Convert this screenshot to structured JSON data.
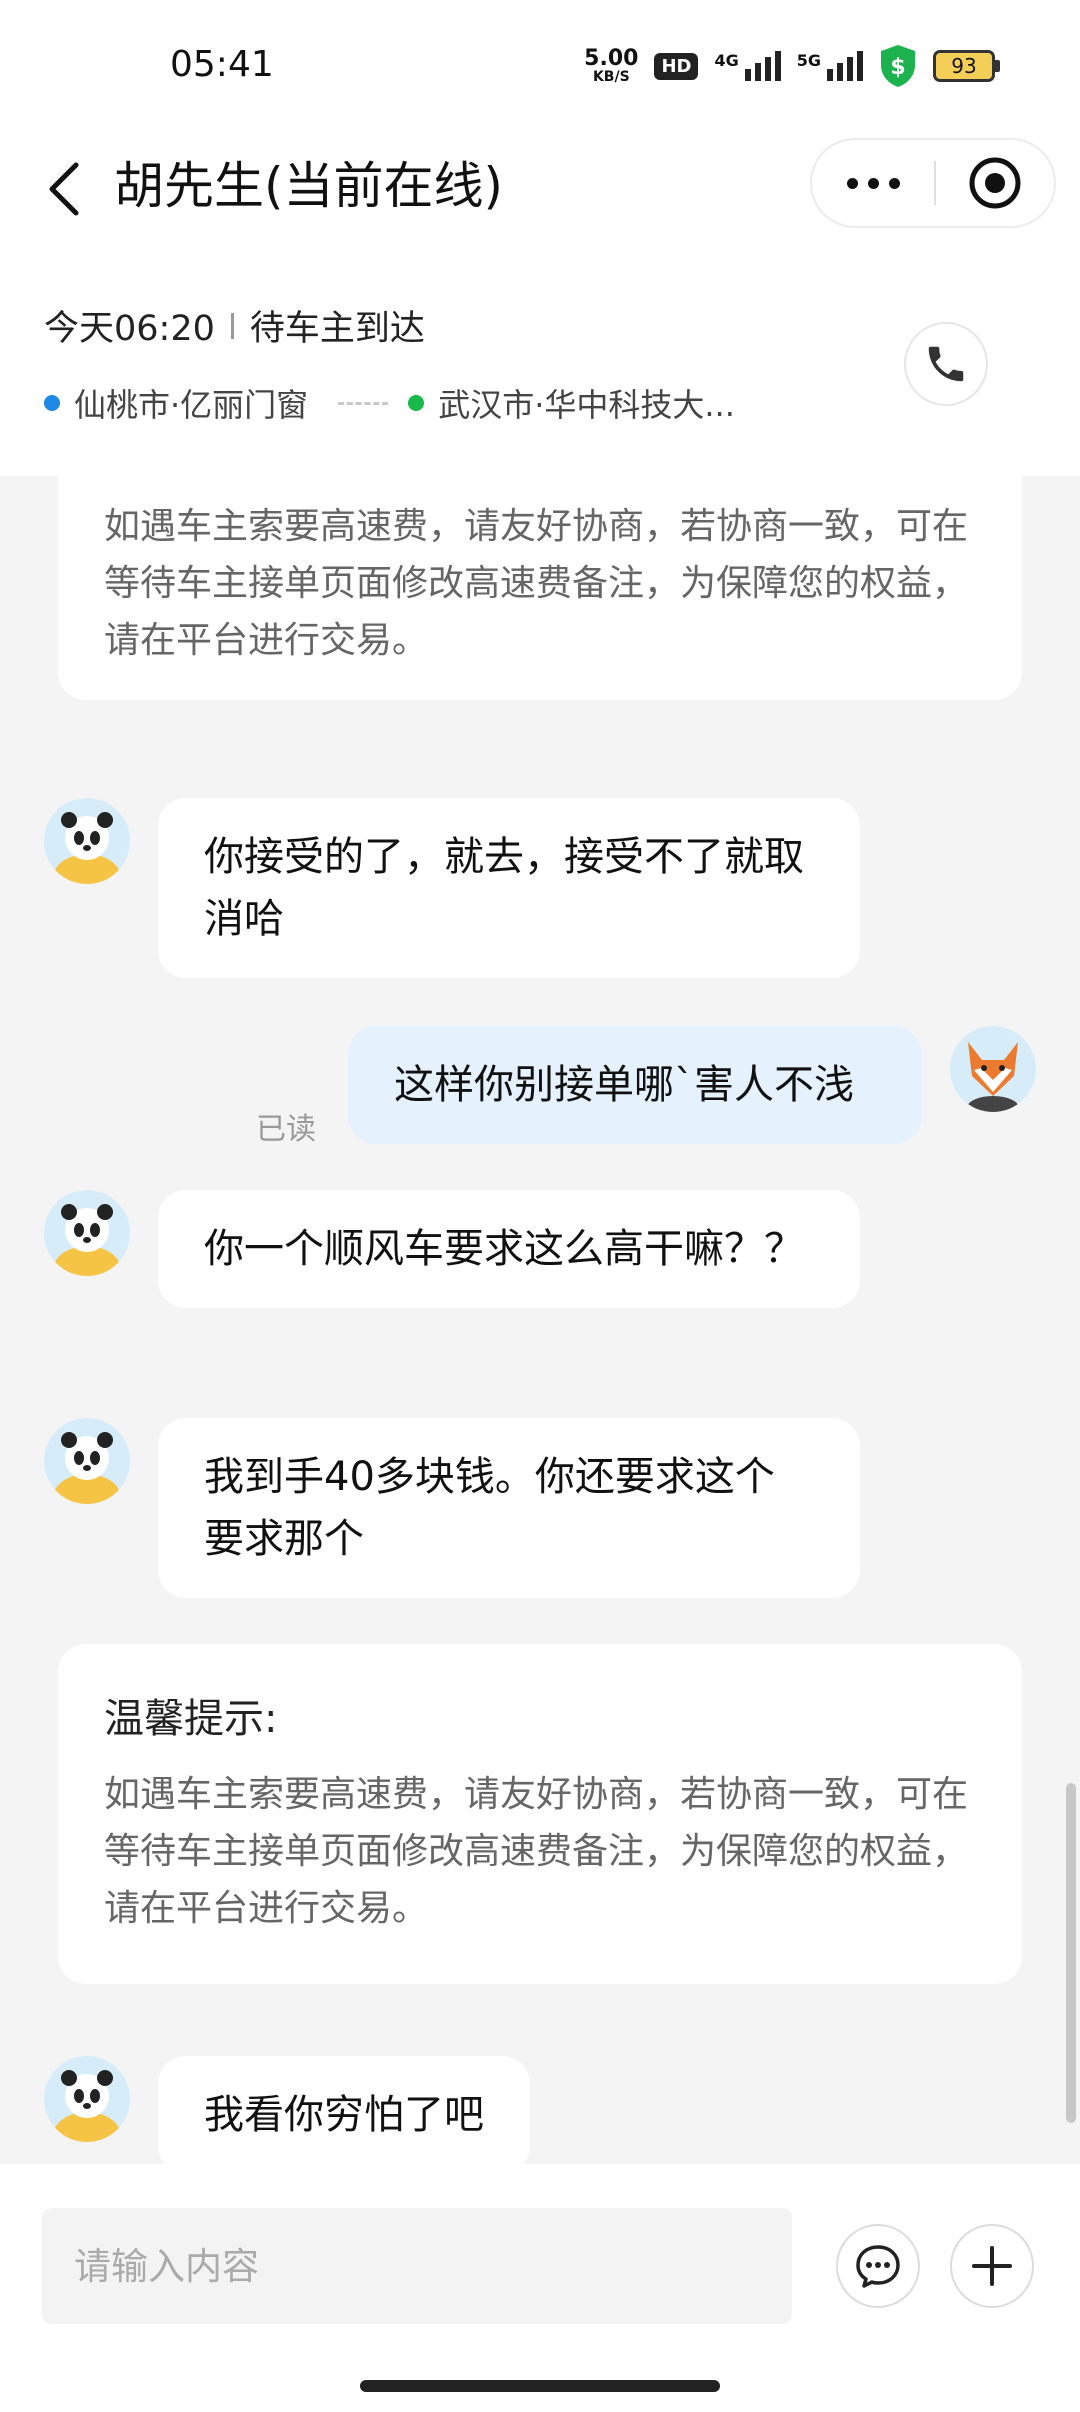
{
  "status_bar": {
    "time": "05:41",
    "speed_value": "5.00",
    "speed_unit": "KB/S",
    "hd_badge": "HD",
    "signal1_label": "4G",
    "signal2_label": "5G",
    "battery": "93"
  },
  "header": {
    "title": "胡先生(当前在线)"
  },
  "trip": {
    "time": "今天06:20",
    "status": "待车主到达",
    "origin": "仙桃市·亿丽门窗",
    "destination": "武汉市·华中科技大...",
    "origin_color": "#1e88e5",
    "destination_color": "#19b84a"
  },
  "chat": {
    "notice_top": {
      "text": "如遇车主索要高速费，请友好协商，若协商一致，可在等待车主接单页面修改高速费备注，为保障您的权益，请在平台进行交易。"
    },
    "messages": [
      {
        "from": "driver",
        "text": "你接受的了，就去，接受不了就取消哈"
      },
      {
        "from": "me",
        "text": "这样你别接单哪`害人不浅",
        "read": "已读"
      },
      {
        "from": "driver",
        "text": "你一个顺风车要求这么高干嘛？？"
      },
      {
        "from": "driver",
        "text": "我到手40多块钱。你还要求这个要求那个"
      },
      {
        "from": "driver",
        "text": "我看你穷怕了吧"
      }
    ],
    "notice_bottom": {
      "title": "温馨提示:",
      "text": "如遇车主索要高速费，请友好协商，若协商一致，可在等待车主接单页面修改高速费备注，为保障您的权益，请在平台进行交易。"
    }
  },
  "input": {
    "placeholder": "请输入内容"
  },
  "icons": {
    "back": "chevron-left-icon",
    "more": "more-dots-icon",
    "target": "target-icon",
    "phone": "phone-icon",
    "quick_reply": "chat-bubble-icon",
    "add": "plus-icon"
  }
}
